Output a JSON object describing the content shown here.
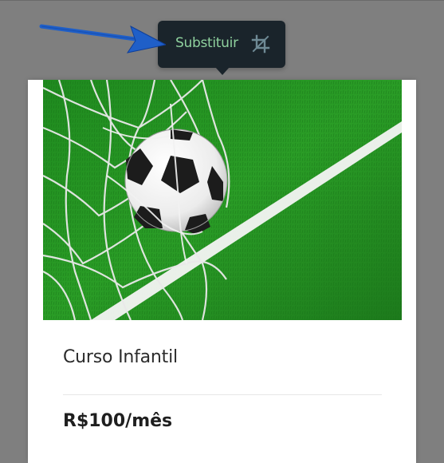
{
  "toolbar": {
    "replace_label": "Substituir",
    "crop_icon": "crop-icon",
    "replace_color": "#8fd19e",
    "background": "#1a242b"
  },
  "annotation": {
    "arrow_color": "#1f5fc8",
    "arrow_icon": "arrow-right-icon"
  },
  "card": {
    "image_icon": "soccer-ball-in-goal-net-image",
    "title": "Curso Infantil",
    "price": "R$100/mês"
  }
}
